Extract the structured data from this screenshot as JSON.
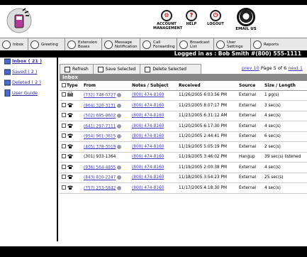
{
  "top": {
    "account": "ACCOUNT MANAGEMENT",
    "help": "HELP",
    "logout": "LOGOUT",
    "email": "EMAIL US"
  },
  "nav": [
    "Inbox",
    "Greeting",
    "Extension Boxes",
    "Message Notification",
    "Call Forwarding",
    "Broadcast List",
    "User Settings",
    "Reports"
  ],
  "user": "Logged in as : Bob Smith  #(800) 555-1111",
  "sidebar": [
    "Inbox ( 21 )",
    "Saved ( 2 )",
    "Deleted ( 2 )",
    "User Guide"
  ],
  "toolbar": {
    "refresh": "Refresh",
    "save": "Save Selected",
    "delete": "Delete Selected"
  },
  "pager": {
    "prev": "prev 10",
    "info": "Page 5 of 6",
    "next": "next 1"
  },
  "inbox_title": "Inbox",
  "columns": [
    "Type",
    "From",
    "Notes / Subject",
    "Received",
    "Source",
    "Size / Length"
  ],
  "rows": [
    {
      "from": "(732) 748-0727",
      "notes": "(800) 474-8160",
      "received": "11/26/2005 6:03:56 PM",
      "source": "External",
      "size": "1 pg(s)"
    },
    {
      "from": "(864) 320-3131",
      "notes": "(800) 474-8160",
      "received": "11/25/2005 8:07:17 PM",
      "source": "External",
      "size": "3 sec(s)"
    },
    {
      "from": "(502) 695-8602",
      "notes": "(800) 474-8160",
      "received": "11/23/2005 6:31:12 AM",
      "source": "External",
      "size": "4 sec(s)"
    },
    {
      "from": "(641) 297-7111",
      "notes": "(800) 474-8160",
      "received": "11/20/2005 6:17:30 PM",
      "source": "External",
      "size": "4 sec(s)"
    },
    {
      "from": "(954) 961-3615",
      "notes": "(800) 474-8160",
      "received": "11/20/2005 2:44:41 PM",
      "source": "External",
      "size": "6 sec(s)"
    },
    {
      "from": "(405) 378-3019",
      "notes": "(800) 474-8160",
      "received": "11/19/2005 5:05:19 PM",
      "source": "External",
      "size": "2 sec(s)"
    },
    {
      "from": "(301) 933-1364",
      "notes": "(800) 474-8160",
      "received": "11/19/2005 3:46:02 PM",
      "source": "Hangup",
      "size": "39 sec(s) listened"
    },
    {
      "from": "(936) 564-4855",
      "notes": "(800) 474-8160",
      "received": "11/19/2005 2:00:38 PM",
      "source": "External",
      "size": "4 sec(s)"
    },
    {
      "from": "(843) 810-2247",
      "notes": "(800) 474-8160",
      "received": "11/18/2005 3:54:23 PM",
      "source": "External",
      "size": "25 sec(s)"
    },
    {
      "from": "(757) 253-5842",
      "notes": "(800) 474-8160",
      "received": "11/17/2005 4:18:30 PM",
      "source": "External",
      "size": "4 sec(s)"
    }
  ]
}
